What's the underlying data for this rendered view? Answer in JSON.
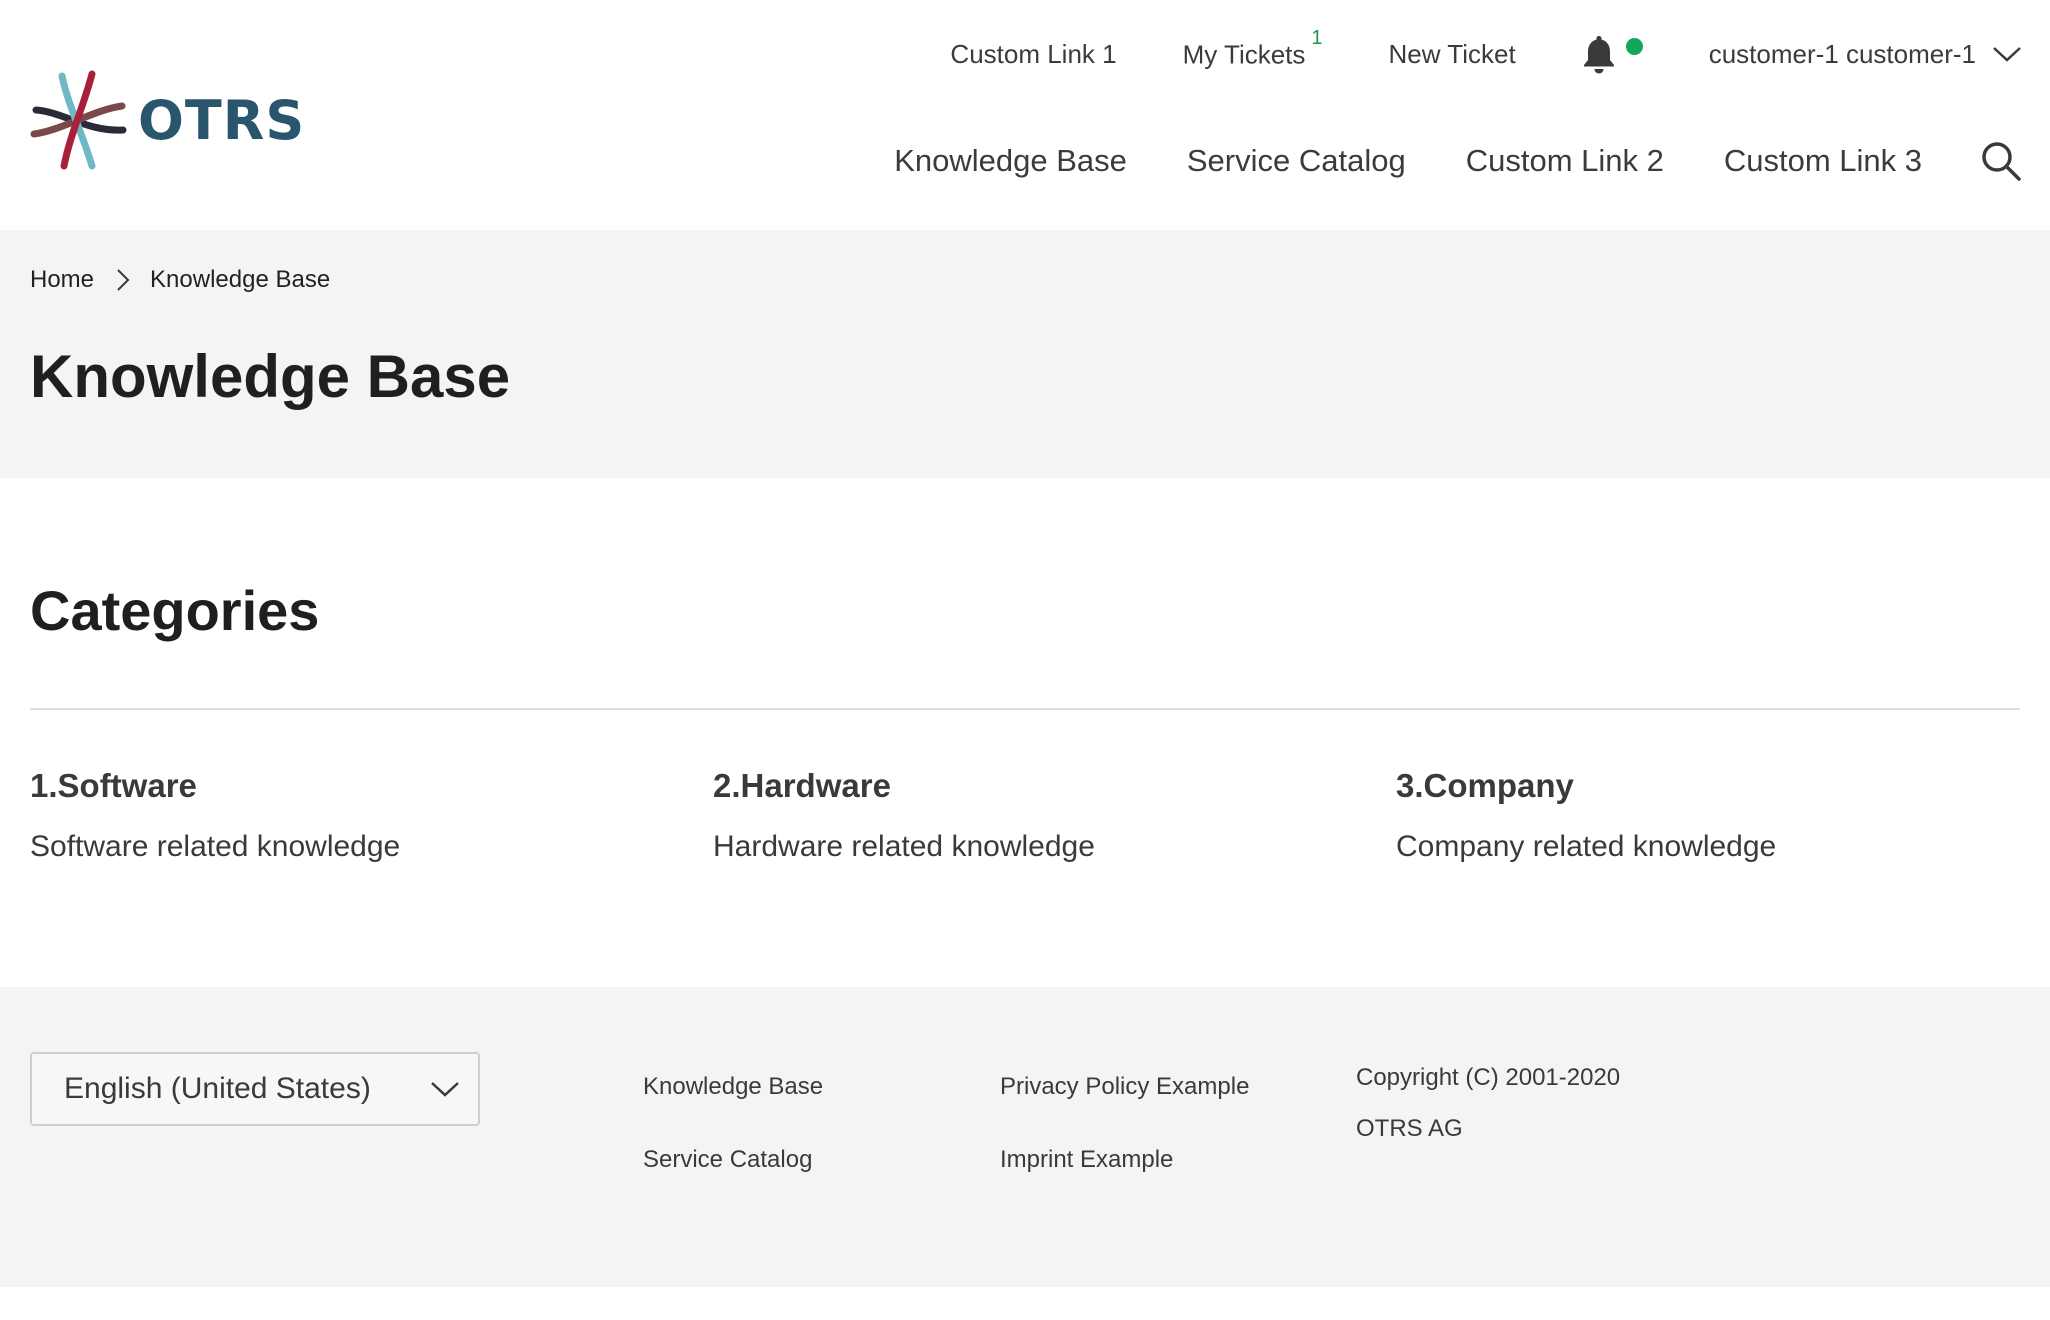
{
  "brand": {
    "name": "OTRS",
    "colors": {
      "primary": "#29566d",
      "red": "#a8203a",
      "brown": "#7a4a4a",
      "teal": "#6fb8c6",
      "dark": "#2a2a38",
      "status_green": "#12a85a"
    }
  },
  "top_nav": {
    "custom_link_1": "Custom Link 1",
    "my_tickets": "My Tickets",
    "my_tickets_count": "1",
    "new_ticket": "New Ticket",
    "notifications_icon": "bell-icon",
    "user_name": "customer-1 customer-1"
  },
  "main_nav": {
    "items": [
      "Knowledge Base",
      "Service Catalog",
      "Custom Link 2",
      "Custom Link 3"
    ],
    "search_icon": "search-icon"
  },
  "breadcrumb": {
    "home": "Home",
    "current": "Knowledge Base"
  },
  "page": {
    "title": "Knowledge Base",
    "section_title": "Categories"
  },
  "categories": [
    {
      "title": "1.Software",
      "description": "Software related knowledge"
    },
    {
      "title": "2.Hardware",
      "description": "Hardware related knowledge"
    },
    {
      "title": "3.Company",
      "description": "Company related knowledge"
    }
  ],
  "footer": {
    "language": "English (United States)",
    "links_col1": [
      "Knowledge Base",
      "Service Catalog"
    ],
    "links_col2": [
      "Privacy Policy Example",
      "Imprint Example"
    ],
    "copyright_line1": "Copyright (C) 2001-2020",
    "copyright_line2": "OTRS AG"
  }
}
